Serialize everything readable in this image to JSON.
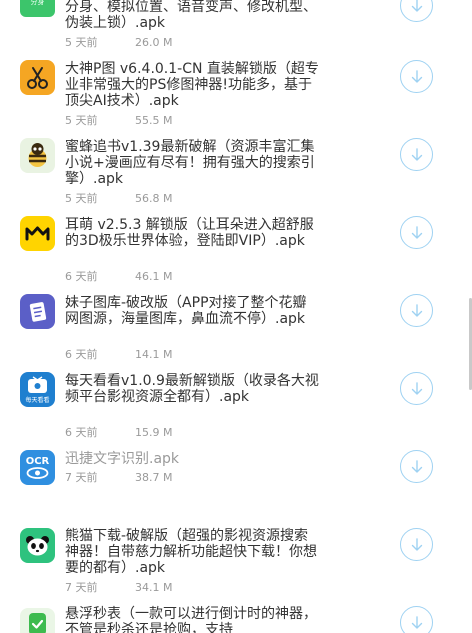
{
  "items": [
    {
      "title": "分身、模拟位置、语音变声、修改机型、伪装上锁）.apk",
      "time": "5 天前",
      "size": "26.0 M",
      "icon": "green-app-icon"
    },
    {
      "title": "大神P图 v6.4.0.1-CN 直装解锁版（超专业非常强大的PS修图神器!功能多，基于顶尖AI技术）.apk",
      "time": "5 天前",
      "size": "55.5 M",
      "icon": "scissors-icon"
    },
    {
      "title": "蜜蜂追书v1.39最新破解（资源丰富汇集小说+漫画应有尽有！拥有强大的搜索引擎）.apk",
      "time": "5 天前",
      "size": "56.8 M",
      "icon": "bee-icon"
    },
    {
      "title": "耳萌 v2.5.3 解锁版（让耳朵进入超舒服的3D极乐世界体验，登陆即VIP）.apk",
      "time": "6 天前",
      "size": "46.1 M",
      "icon": "ermeng-icon"
    },
    {
      "title": "妹子图库-破改版（APP对接了整个花瓣网图源，海量图库，鼻血流不停）.apk",
      "time": "6 天前",
      "size": "14.1 M",
      "icon": "book-icon"
    },
    {
      "title": "每天看看v1.0.9最新解锁版（收录各大视频平台影视资源全都有）.apk",
      "time": "6 天前",
      "size": "15.9 M",
      "icon": "tv-icon",
      "icon_caption": "每天看看"
    },
    {
      "title": "迅捷文字识别.apk",
      "time": "7 天前",
      "size": "38.7 M",
      "icon": "ocr-icon",
      "icon_text": "OCR"
    },
    {
      "title": "熊猫下载-破解版（超强的影视资源搜索神器！自带慈力解析功能超快下载！你想要的都有）.apk",
      "time": "7 天前",
      "size": "34.1 M",
      "icon": "panda-icon"
    },
    {
      "title": "悬浮秒表（一款可以进行倒计时的神器，不管是秒杀还是抢购，支持",
      "time": "",
      "size": "",
      "icon": "check-icon"
    }
  ]
}
